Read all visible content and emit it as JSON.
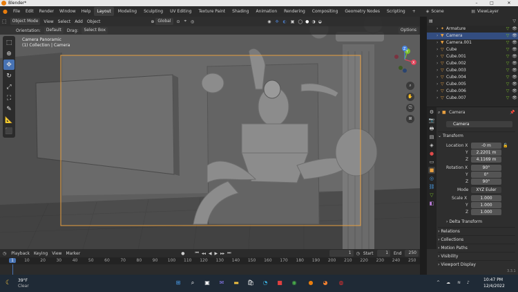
{
  "window": {
    "title": "Blender*"
  },
  "menu": [
    "File",
    "Edit",
    "Render",
    "Window",
    "Help"
  ],
  "workspaces": [
    "Layout",
    "Modeling",
    "Sculpting",
    "UV Editing",
    "Texture Paint",
    "Shading",
    "Animation",
    "Rendering",
    "Compositing",
    "Geometry Nodes",
    "Scripting"
  ],
  "workspace_add": "+",
  "scene": "Scene",
  "view_layer": "ViewLayer",
  "header": {
    "mode": "Object Mode",
    "view": "View",
    "select": "Select",
    "add": "Add",
    "object": "Object",
    "transform_orientation": "Global",
    "options": "Options"
  },
  "subheader": {
    "orientation_label": "Orientation:",
    "orientation_value": "Default",
    "drag_label": "Drag:",
    "drag_value": "Select Box"
  },
  "viewport": {
    "line1": "Camera Panoramic",
    "line2": "(1) Collection | Camera"
  },
  "gizmo": {
    "x": "X",
    "y": "Y",
    "z": "Z"
  },
  "outliner": {
    "items": [
      {
        "name": "Armature",
        "icon": "armature-icon",
        "selected": false
      },
      {
        "name": "Camera",
        "icon": "camera-icon",
        "selected": true
      },
      {
        "name": "Camera.001",
        "icon": "camera-icon",
        "selected": false
      },
      {
        "name": "Cube",
        "icon": "mesh-icon",
        "selected": false
      },
      {
        "name": "Cube.001",
        "icon": "mesh-icon",
        "selected": false
      },
      {
        "name": "Cube.002",
        "icon": "mesh-icon",
        "selected": false
      },
      {
        "name": "Cube.003",
        "icon": "mesh-icon",
        "selected": false
      },
      {
        "name": "Cube.004",
        "icon": "mesh-icon",
        "selected": false
      },
      {
        "name": "Cube.005",
        "icon": "mesh-icon",
        "selected": false
      },
      {
        "name": "Cube.006",
        "icon": "mesh-icon",
        "selected": false
      },
      {
        "name": "Cube.007",
        "icon": "mesh-icon",
        "selected": false
      }
    ]
  },
  "properties": {
    "object_name": "Camera",
    "object_name_field": "Camera",
    "transform_title": "Transform",
    "location_label": "Location X",
    "loc_x": "-0 m",
    "loc_y": "2.2201 m",
    "loc_z": "4.1169 m",
    "rotation_label": "Rotation X",
    "rot_x": "90°",
    "rot_y": "0°",
    "rot_z": "90°",
    "mode_label": "Mode",
    "mode_value": "XYZ Euler",
    "scale_label": "Scale X",
    "scale_x": "1.000",
    "scale_y": "1.000",
    "scale_z": "1.000",
    "y_label": "Y",
    "z_label": "Z",
    "delta_transform": "Delta Transform",
    "sections": [
      "Relations",
      "Collections",
      "Motion Paths",
      "Visibility",
      "Viewport Display"
    ]
  },
  "timeline": {
    "playback": "Playback",
    "keying": "Keying",
    "view": "View",
    "marker": "Marker",
    "current_frame": "1",
    "start_label": "Start",
    "start": "1",
    "end_label": "End",
    "end": "250",
    "ticks": [
      "1",
      "10",
      "20",
      "30",
      "40",
      "50",
      "60",
      "70",
      "80",
      "90",
      "100",
      "110",
      "120",
      "130",
      "140",
      "150",
      "160",
      "170",
      "180",
      "190",
      "200",
      "210",
      "220",
      "230",
      "240",
      "250"
    ],
    "version": "3.3.1"
  },
  "taskbar": {
    "weather_temp": "39°F",
    "weather_desc": "Clear",
    "time": "10:47 PM",
    "date": "12/4/2022"
  },
  "colors": {
    "accent": "#4772b3",
    "camera_frame": "#e8a040"
  }
}
